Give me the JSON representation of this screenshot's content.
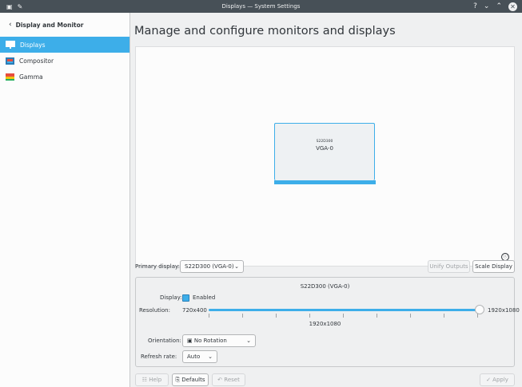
{
  "window": {
    "title": "Displays — System Settings",
    "controls": [
      "?",
      "⌄",
      "⌃",
      "✕"
    ]
  },
  "sidebar": {
    "back_label": "Display and Monitor",
    "items": [
      {
        "label": "Displays",
        "icon": "display-icon",
        "active": true
      },
      {
        "label": "Compositor",
        "icon": "compositor-icon",
        "active": false
      },
      {
        "label": "Gamma",
        "icon": "gamma-icon",
        "active": false
      }
    ]
  },
  "main": {
    "heading": "Manage and configure monitors and displays",
    "monitor": {
      "model": "S22D300",
      "output": "VGA-0"
    },
    "info_icon": "ⓘ"
  },
  "toolbar": {
    "primary_label": "Primary display:",
    "primary_value": "S22D300 (VGA-0)",
    "unify_label": "Unify Outputs",
    "scale_label": "Scale Display"
  },
  "output_panel": {
    "title": "S22D300 (VGA-0)",
    "display_label": "Display:",
    "enabled_label": "Enabled",
    "resolution_label": "Resolution:",
    "res_min": "720x400",
    "res_max": "1920x1080",
    "res_current": "1920x1080",
    "res_level": 1.0,
    "orientation_label": "Orientation:",
    "orientation_value": "No Rotation",
    "refresh_label": "Refresh rate:",
    "refresh_value": "Auto"
  },
  "footer": {
    "help": "Help",
    "defaults": "Defaults",
    "reset": "Reset",
    "apply": "Apply"
  },
  "colors": {
    "accent": "#3daee9",
    "titlebar": "#475057",
    "window_bg": "#eff0f1"
  }
}
